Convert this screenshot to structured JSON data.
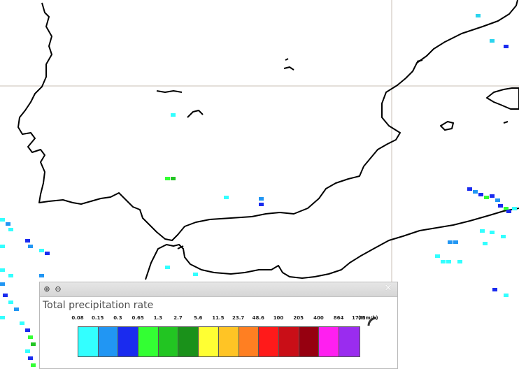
{
  "legend": {
    "title": "Total precipitation rate",
    "unit": "(mm/h)",
    "zoom_in_icon": "zoom-in-icon",
    "zoom_out_icon": "zoom-out-icon",
    "close_icon": "close-icon",
    "thresholds": [
      "0.08",
      "0.15",
      "0.3",
      "0.65",
      "1.3",
      "2.7",
      "5.6",
      "11.5",
      "23.7",
      "48.6",
      "100",
      "205",
      "400",
      "864",
      "1775"
    ],
    "colors": [
      "#33ffff",
      "#2196f3",
      "#1a2bef",
      "#33ff33",
      "#22c522",
      "#1a911a",
      "#ffff33",
      "#ffc425",
      "#ff7f22",
      "#ff1a1a",
      "#c90e17",
      "#960010",
      "#ff1ff0",
      "#9a2cef"
    ]
  },
  "map": {
    "land_color": "#ffffff",
    "coastline_color": "#000000",
    "grid_color": "#c8bfb4"
  }
}
